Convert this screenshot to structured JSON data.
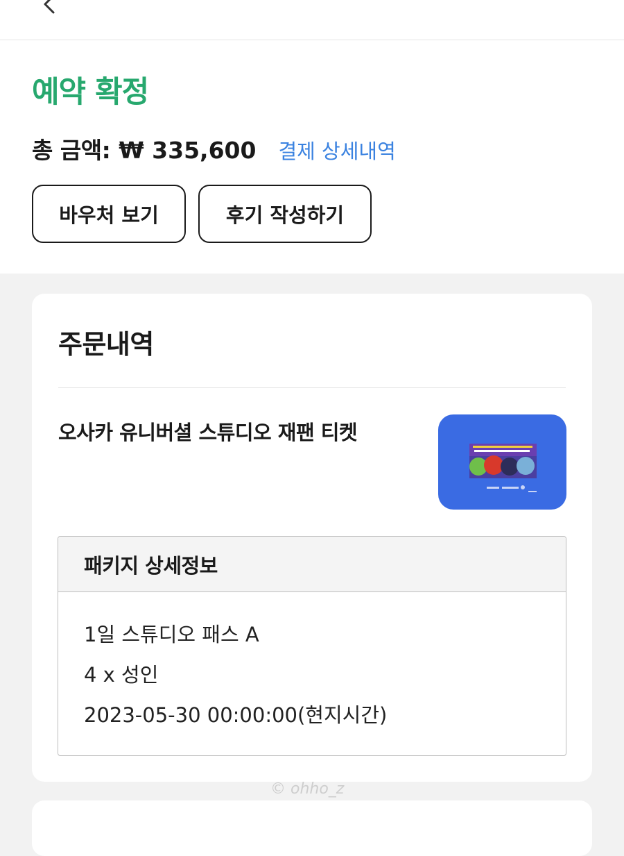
{
  "colors": {
    "status_green": "#27a86e",
    "link_blue": "#3a82e0",
    "thumb_blue": "#3a6be3"
  },
  "nav": {
    "back_icon": "chevron-left-icon"
  },
  "header": {
    "status": "예약 확정",
    "total_label": "총 금액:",
    "total_amount": "₩ 335,600",
    "payment_detail_link": "결제 상세내역",
    "voucher_button": "바우처 보기",
    "review_button": "후기 작성하기"
  },
  "order": {
    "title": "주문내역",
    "product_name": "오사카 유니버셜 스튜디오 재팬 티켓",
    "thumbnail_icon": "ticket-poster-image",
    "package": {
      "header": "패키지 상세정보",
      "option": "1일 스튜디오 패스 A",
      "quantity": "4 x 성인",
      "datetime": "2023-05-30 00:00:00(현지시간)"
    }
  },
  "watermark": "© ohho_z"
}
